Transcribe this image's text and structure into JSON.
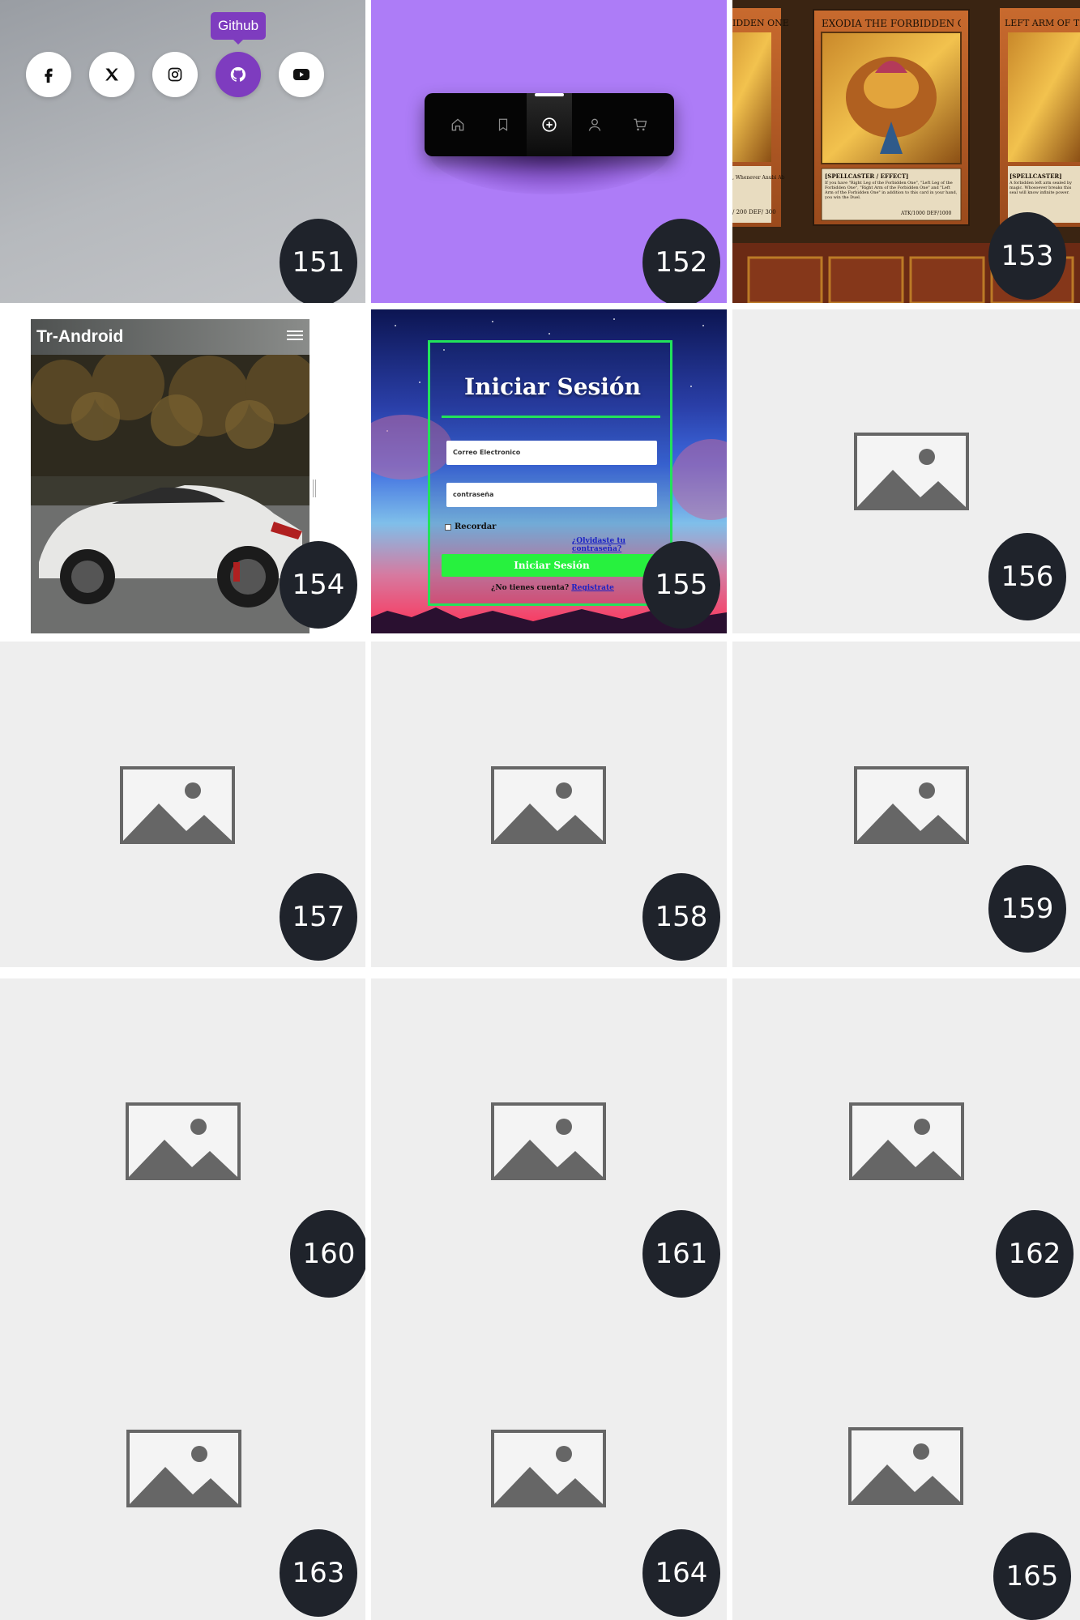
{
  "tiles": [
    {
      "number": "151"
    },
    {
      "number": "152"
    },
    {
      "number": "153"
    },
    {
      "number": "154"
    },
    {
      "number": "155"
    },
    {
      "number": "156"
    },
    {
      "number": "157"
    },
    {
      "number": "158"
    },
    {
      "number": "159"
    },
    {
      "number": "160"
    },
    {
      "number": "161"
    },
    {
      "number": "162"
    },
    {
      "number": "163"
    },
    {
      "number": "164"
    },
    {
      "number": "165"
    }
  ],
  "social": {
    "tooltip": "Github",
    "icons": [
      "facebook-icon",
      "x-icon",
      "instagram-icon",
      "github-icon",
      "youtube-icon"
    ],
    "active_color": "#7e3cbf"
  },
  "navbar": {
    "icons": [
      "home-icon",
      "bookmark-icon",
      "add-icon",
      "user-icon",
      "cart-icon"
    ],
    "active_index": 2
  },
  "cards": {
    "left_title": "IDDEN ONE",
    "center_title": "EXODIA THE FORBIDDEN ONE",
    "right_title": "LEFT ARM OF THE FORBIDDEN",
    "center_type": "[SPELLCASTER / EFFECT]",
    "center_text": "If you have \"Right Leg of the Forbidden One\", \"Left Leg of the Forbidden One\", \"Right Arm of the Forbidden One\" and \"Left Arm of the Forbidden One\" in addition to this card in your hand, you win the Duel.",
    "center_stats": "ATK/1000  DEF/1000",
    "left_stats": "/ 200  DEF/ 300",
    "left_text": ", Whenever Anubi Ab",
    "right_type": "[SPELLCASTER]",
    "right_text": "A forbidden left arm sealed by magic. Whosoever breaks this seal will know infinite power."
  },
  "mobile_preview": {
    "brand": "Tr-Android"
  },
  "login": {
    "title": "Iniciar Sesión",
    "email_placeholder": "Correo Electronico",
    "password_placeholder": "contraseña",
    "remember_label": "Recordar",
    "forgot_link": "¿Olvidaste tu contraseña?",
    "submit_label": "Iniciar Sesión",
    "no_account_text": "¿No tienes cuenta?",
    "register_link": "Registrate",
    "accent_color": "#27f13e"
  },
  "placeholder_icon": "image-placeholder-icon"
}
